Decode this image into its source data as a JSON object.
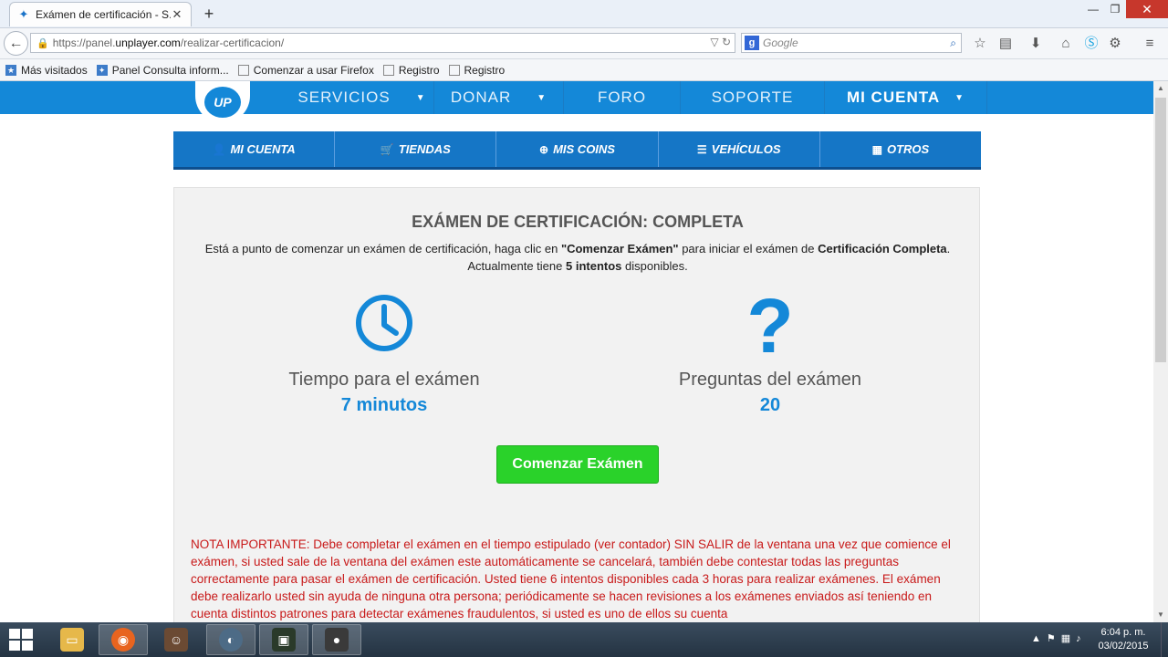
{
  "browser": {
    "tab_title": "Exámen de certificación - S...",
    "url_prefix": "https://panel.",
    "url_domain": "unplayer.com",
    "url_path": "/realizar-certificacion/",
    "search_placeholder": "Google",
    "bookmarks": [
      "Más visitados",
      "Panel Consulta inform...",
      "Comenzar a usar Firefox",
      "Registro",
      "Registro"
    ]
  },
  "site": {
    "logo_text": "UP",
    "main_nav": [
      "SERVICIOS",
      "DONAR",
      "FORO",
      "SOPORTE",
      "MI CUENTA"
    ],
    "sub_nav": [
      "MI CUENTA",
      "TIENDAS",
      "MIS COINS",
      "VEHÍCULOS",
      "OTROS"
    ]
  },
  "exam": {
    "title": "EXÁMEN DE CERTIFICACIÓN: COMPLETA",
    "intro_1": "Está a punto de comenzar un exámen de certificación, haga clic en ",
    "intro_btn_ref": "\"Comenzar Exámen\"",
    "intro_2": " para iniciar el exámen de ",
    "intro_cert": "Certificación Completa",
    "intro_3": ". Actualmente tiene ",
    "intro_attempts": "5 intentos",
    "intro_4": " disponibles.",
    "time_label": "Tiempo para el exámen",
    "time_value": "7 minutos",
    "questions_label": "Preguntas del exámen",
    "questions_value": "20",
    "question_glyph": "?",
    "start_button": "Comenzar Exámen",
    "warning": "NOTA IMPORTANTE: Debe completar el exámen en el tiempo estipulado (ver contador) SIN SALIR de la ventana una vez que comience el exámen, si usted sale de la ventana del exámen este automáticamente se cancelará, también debe contestar todas las preguntas correctamente para pasar el exámen de certificación. Usted tiene 6 intentos disponibles cada 3 horas para realizar exámenes. El exámen debe realizarlo usted sin ayuda de ninguna otra persona; periódicamente se hacen revisiones a los exámenes enviados así teniendo en cuenta distintos patrones para detectar exámenes fraudulentos, si usted es uno de ellos su cuenta"
  },
  "taskbar": {
    "time": "6:04 p. m.",
    "date": "03/02/2015"
  },
  "colors": {
    "brand_blue": "#1488d8",
    "subnav_blue": "#1576c6",
    "button_green": "#2ad22a",
    "warning_red": "#c81a1a"
  }
}
